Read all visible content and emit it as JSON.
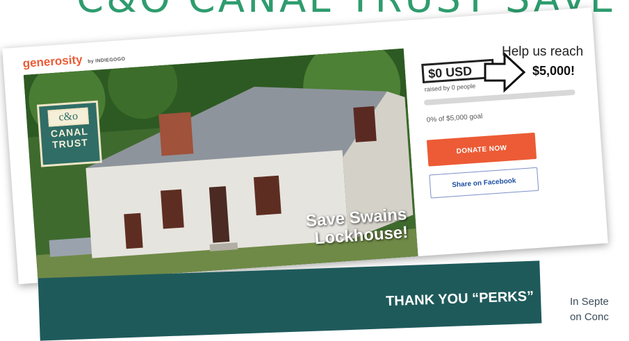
{
  "banner": {
    "text": "C&O CANAL TRUST SAVE SWAINS LOCKHOUSE"
  },
  "campaign": {
    "brand": "generosity",
    "brand_by": "by INDIEGOGO",
    "logo_line0": "c&o",
    "logo_line1": "CANAL",
    "logo_line2": "TRUST",
    "photo_caption_line1": "Save Swains",
    "photo_caption_line2": "Lockhouse!",
    "amount": "$0 USD",
    "raised_by": "raised by 0 people",
    "progress": 0,
    "goal_text": "0% of $5,000 goal",
    "donate_label": "DONATE NOW",
    "share_label": "Share on Facebook"
  },
  "callout": {
    "line1": "Help us reach",
    "line2": "$5,000!"
  },
  "perks": {
    "title": "THANK YOU “PERKS”"
  },
  "side_text": {
    "line1": "In Septe",
    "line2": "on Conc"
  },
  "colors": {
    "accent": "#ec5b35",
    "teal": "#1f5a5b",
    "banner_green": "#2e9c6e"
  }
}
